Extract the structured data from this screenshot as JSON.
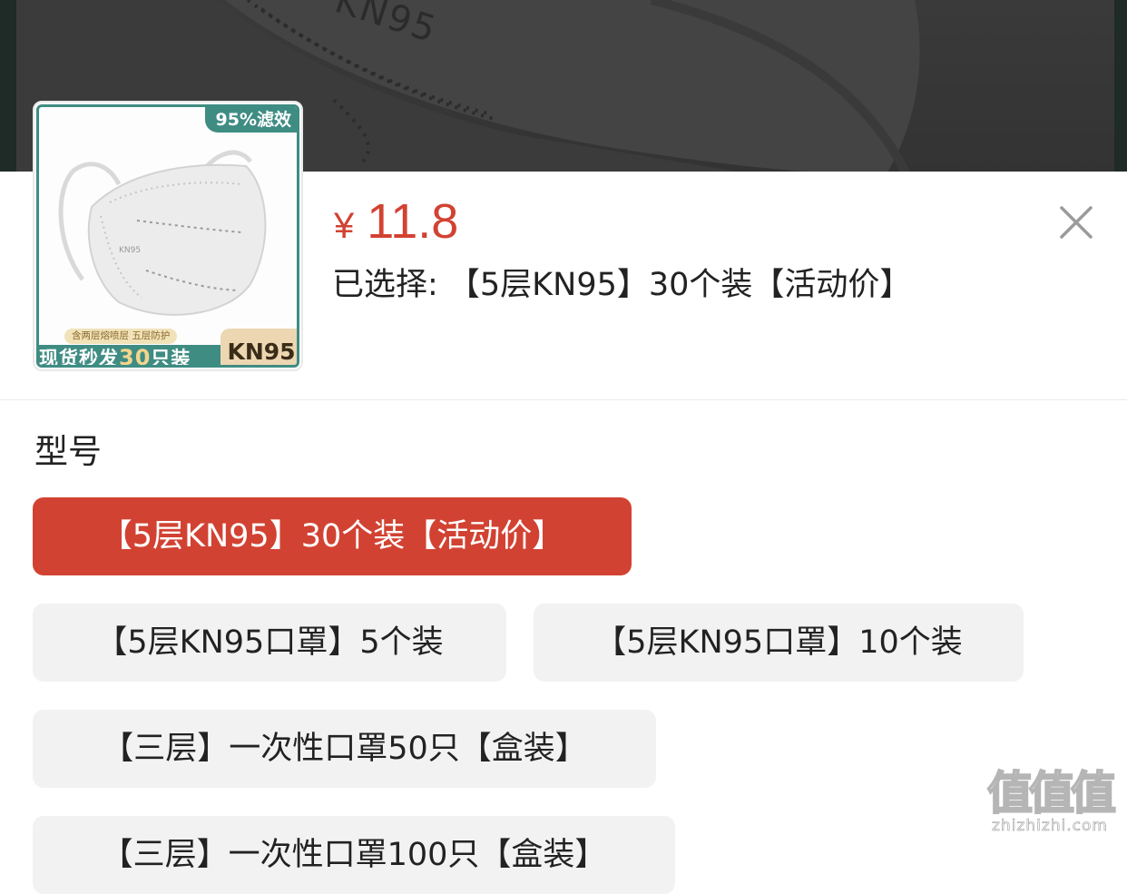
{
  "backdrop": {
    "photo_text": "KN95"
  },
  "thumbnail": {
    "filter_badge": "95%滤效",
    "small_tags": "含两层熔喷层  五层防护",
    "bottom_text_before": "现货秒发",
    "bottom_number": "30",
    "bottom_text_after": "只装",
    "kn95_badge": "KN95"
  },
  "price": {
    "currency": "¥",
    "value": "11.8"
  },
  "selection": {
    "text": "已选择: 【5层KN95】30个装【活动价】"
  },
  "close": {
    "icon": "close-icon"
  },
  "variants": {
    "title": "型号",
    "options": [
      {
        "label": "【5层KN95】30个装【活动价】",
        "selected": true
      },
      {
        "label": "【5层KN95口罩】5个装",
        "selected": false
      },
      {
        "label": "【5层KN95口罩】10个装",
        "selected": false
      },
      {
        "label": "【三层】一次性口罩50只【盒装】",
        "selected": false
      },
      {
        "label": "【三层】一次性口罩100只【盒装】",
        "selected": false
      }
    ]
  },
  "colors": {
    "accent": "#d24232",
    "chip_bg": "#f2f2f2",
    "thumb_teal": "#3f8c83",
    "backdrop": "#333333"
  },
  "watermark": {
    "logo": "值值值",
    "url": "zhizhizhi.com"
  }
}
